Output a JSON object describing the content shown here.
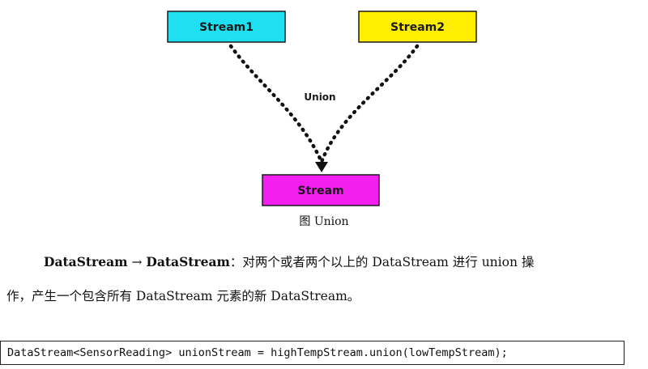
{
  "diagram": {
    "nodes": [
      {
        "id": "stream1",
        "label": "Stream1",
        "color": "#1ee0f0"
      },
      {
        "id": "stream2",
        "label": "Stream2",
        "color": "#ffee00"
      },
      {
        "id": "stream",
        "label": "Stream",
        "color": "#f51ef0"
      }
    ],
    "edges": [
      {
        "from": "stream1",
        "to": "stream",
        "style": "dotted"
      },
      {
        "from": "stream2",
        "to": "stream",
        "style": "dotted"
      }
    ],
    "edge_label": "Union"
  },
  "caption": "图 Union",
  "paragraph": {
    "term_from": "DataStream",
    "arrow": "→",
    "term_to": "DataStream",
    "line1_rest": "：对两个或者两个以上的 DataStream 进行 union 操",
    "line2": "作，产生一个包含所有 DataStream 元素的新 DataStream。"
  },
  "code": "DataStream<SensorReading> unionStream = highTempStream.union(lowTempStream);"
}
